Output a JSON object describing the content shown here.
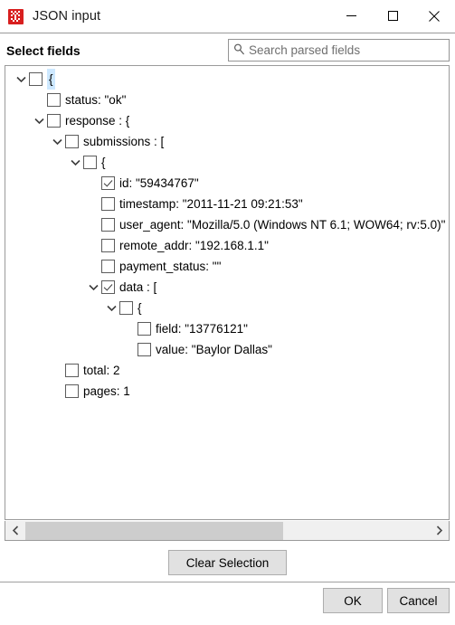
{
  "window": {
    "title": "JSON input",
    "icon": "json-node-graph-icon",
    "controls": {
      "minimize": "minimize-icon",
      "maximize": "maximize-icon",
      "close": "close-icon"
    }
  },
  "header": {
    "select_fields_label": "Select fields",
    "search": {
      "icon": "search-icon",
      "placeholder": "Search parsed fields",
      "value": ""
    }
  },
  "tree": {
    "rows": [
      {
        "indent": 0,
        "twisty": "expanded",
        "checked": false,
        "label": "{",
        "selected": true
      },
      {
        "indent": 1,
        "twisty": "none",
        "checked": false,
        "label": "status: \"ok\"",
        "selected": false
      },
      {
        "indent": 1,
        "twisty": "expanded",
        "checked": false,
        "label": "response : {",
        "selected": false
      },
      {
        "indent": 2,
        "twisty": "expanded",
        "checked": false,
        "label": "submissions : [",
        "selected": false
      },
      {
        "indent": 3,
        "twisty": "expanded",
        "checked": false,
        "label": "{",
        "selected": false
      },
      {
        "indent": 4,
        "twisty": "none",
        "checked": true,
        "label": "id: \"59434767\"",
        "selected": false
      },
      {
        "indent": 4,
        "twisty": "none",
        "checked": false,
        "label": "timestamp: \"2011-11-21 09:21:53\"",
        "selected": false
      },
      {
        "indent": 4,
        "twisty": "none",
        "checked": false,
        "label": "user_agent: \"Mozilla/5.0 (Windows NT 6.1; WOW64; rv:5.0)\"",
        "selected": false
      },
      {
        "indent": 4,
        "twisty": "none",
        "checked": false,
        "label": "remote_addr: \"192.168.1.1\"",
        "selected": false
      },
      {
        "indent": 4,
        "twisty": "none",
        "checked": false,
        "label": "payment_status: \"\"",
        "selected": false
      },
      {
        "indent": 4,
        "twisty": "expanded",
        "checked": true,
        "label": "data : [",
        "selected": false
      },
      {
        "indent": 5,
        "twisty": "expanded",
        "checked": false,
        "label": "{",
        "selected": false
      },
      {
        "indent": 6,
        "twisty": "none",
        "checked": false,
        "label": "field: \"13776121\"",
        "selected": false
      },
      {
        "indent": 6,
        "twisty": "none",
        "checked": false,
        "label": "value: \"Baylor Dallas\"",
        "selected": false
      },
      {
        "indent": 2,
        "twisty": "none",
        "checked": false,
        "label": "total: 2",
        "selected": false
      },
      {
        "indent": 2,
        "twisty": "none",
        "checked": false,
        "label": "pages: 1",
        "selected": false
      }
    ]
  },
  "scrollbar": {
    "left_arrow": "chevron-left-icon",
    "right_arrow": "chevron-right-icon"
  },
  "buttons": {
    "clear_selection": "Clear Selection",
    "ok": "OK",
    "cancel": "Cancel"
  },
  "colors": {
    "accent_icon_red": "#d81f1f",
    "selection_blue": "#cde8ff",
    "button_face": "#e1e1e1",
    "scroll_thumb": "#cdcdcd"
  }
}
